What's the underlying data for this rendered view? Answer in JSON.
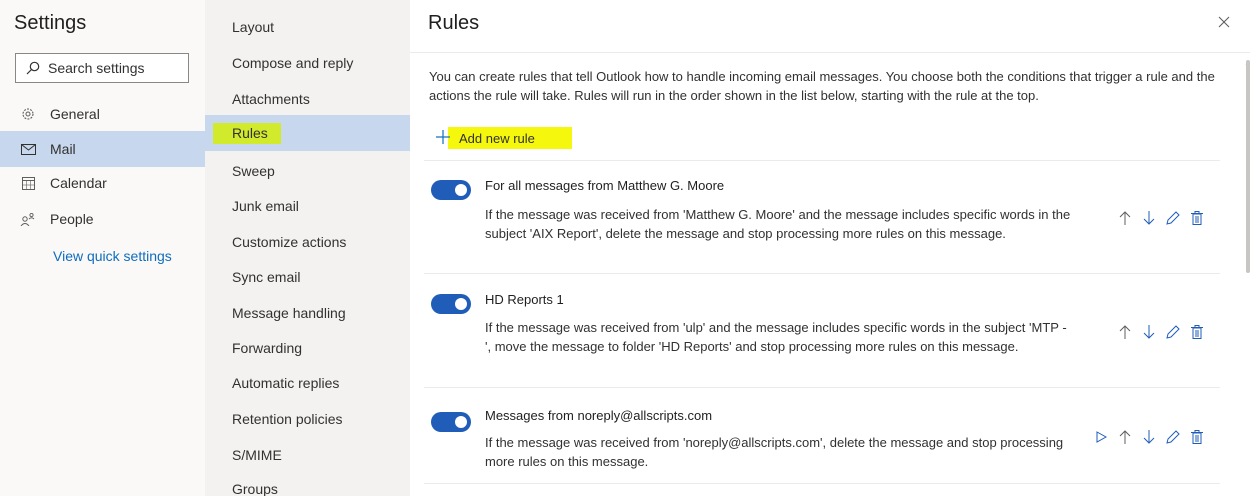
{
  "settings": {
    "title": "Settings",
    "search_placeholder": "Search settings",
    "nav": [
      {
        "label": "General",
        "icon": "gear-icon"
      },
      {
        "label": "Mail",
        "icon": "mail-icon"
      },
      {
        "label": "Calendar",
        "icon": "calendar-icon"
      },
      {
        "label": "People",
        "icon": "people-icon"
      }
    ],
    "quick_settings_link": "View quick settings"
  },
  "mail_menu": [
    "Layout",
    "Compose and reply",
    "Attachments",
    "Rules",
    "Sweep",
    "Junk email",
    "Customize actions",
    "Sync email",
    "Message handling",
    "Forwarding",
    "Automatic replies",
    "Retention policies",
    "S/MIME",
    "Groups"
  ],
  "main": {
    "title": "Rules",
    "description": "You can create rules that tell Outlook how to handle incoming email messages. You choose both the conditions that trigger a rule and the actions the rule will take. Rules will run in the order shown in the list below, starting with the rule at the top.",
    "add_rule_label": "Add new rule",
    "rules": [
      {
        "name": "For all messages from Matthew G. Moore",
        "description": "If the message was received from 'Matthew G. Moore' and the message includes specific words in the subject 'AIX Report', delete the message and stop processing more rules on this message.",
        "enabled": true
      },
      {
        "name": "HD Reports 1",
        "description": "If the message was received from 'ulp' and the message includes specific words in the subject 'MTP - ', move the message to folder 'HD Reports' and stop processing more rules on this message.",
        "enabled": true
      },
      {
        "name": "Messages from noreply@allscripts.com",
        "description": "If the message was received from 'noreply@allscripts.com', delete the message and stop processing more rules on this message.",
        "enabled": true
      }
    ]
  },
  "colors": {
    "accent": "#1f5db9",
    "selected": "#c7d7ee",
    "highlight": "#f5f80d"
  }
}
